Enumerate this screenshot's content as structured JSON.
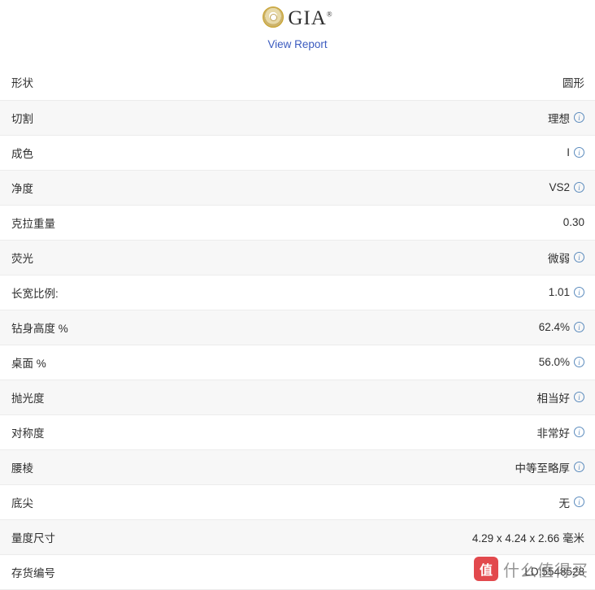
{
  "header": {
    "logo_text": "GIA",
    "logo_reg": "®",
    "seal_icon": "gia-seal-icon",
    "view_report_label": "View Report"
  },
  "spec": {
    "rows": [
      {
        "label": "形状",
        "value": "圆形",
        "info": false
      },
      {
        "label": "切割",
        "value": "理想",
        "info": true
      },
      {
        "label": "成色",
        "value": "I",
        "info": true
      },
      {
        "label": "净度",
        "value": "VS2",
        "info": true
      },
      {
        "label": "克拉重量",
        "value": "0.30",
        "info": false
      },
      {
        "label": "荧光",
        "value": "微弱",
        "info": true
      },
      {
        "label": "长宽比例:",
        "value": "1.01",
        "info": true
      },
      {
        "label": "钻身高度 %",
        "value": "62.4%",
        "info": true
      },
      {
        "label": "桌面 %",
        "value": "56.0%",
        "info": true
      },
      {
        "label": "抛光度",
        "value": "相当好",
        "info": true
      },
      {
        "label": "对称度",
        "value": "非常好",
        "info": true
      },
      {
        "label": "腰棱",
        "value": "中等至略厚",
        "info": true
      },
      {
        "label": "底尖",
        "value": "无",
        "info": true
      },
      {
        "label": "量度尺寸",
        "value": "4.29 x 4.24 x 2.66 毫米",
        "info": false
      },
      {
        "label": "存货编号",
        "value": "LD:5548528",
        "info": false
      }
    ],
    "info_icon": "info-icon"
  },
  "watermark": {
    "badge_text": "值",
    "text": "什么值得买"
  }
}
